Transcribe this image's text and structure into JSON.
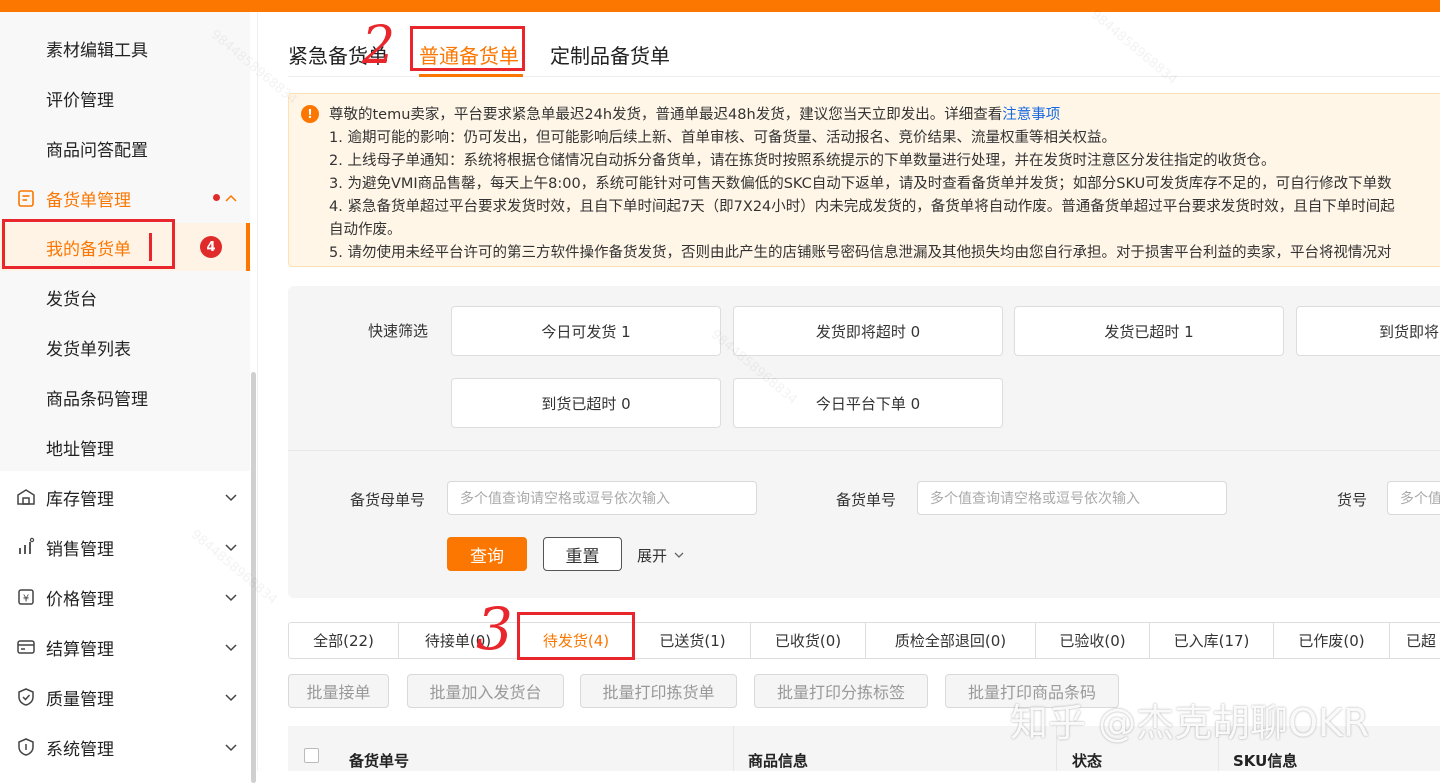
{
  "sidebar": {
    "sub_items": [
      "素材编辑工具",
      "评价管理",
      "商品问答配置"
    ],
    "group_title": "备货单管理",
    "active_item": "我的备货单",
    "active_badge": "4",
    "group_items": [
      "发货台",
      "发货单列表",
      "商品条码管理",
      "地址管理"
    ],
    "collapsed_groups": [
      "库存管理",
      "销售管理",
      "价格管理",
      "结算管理",
      "质量管理",
      "系统管理"
    ]
  },
  "tabs": [
    "紧急备货单",
    "普通备货单",
    "定制品备货单"
  ],
  "notice": {
    "line0_prefix": "尊敬的temu卖家，平台要求紧急单最迟24h发货，普通单最迟48h发货，建议您当天立即发出。详细查看",
    "line0_link": "注意事项",
    "lines": [
      "1. 逾期可能的影响：仍可发出，但可能影响后续上新、首单审核、可备货量、活动报名、竞价结果、流量权重等相关权益。",
      "2. 上线母子单通知：系统将根据仓储情况自动拆分备货单，请在拣货时按照系统提示的下单数量进行处理，并在发货时注意区分发往指定的收货仓。",
      "3. 为避免VMI商品售罄，每天上午8:00，系统可能针对可售天数偏低的SKC自动下返单，请及时查看备货单并发货；如部分SKU可发货库存不足的，可自行修改下单数",
      "4. 紧急备货单超过平台要求发货时效，且自下单时间起7天（即7X24小时）内未完成发货的，备货单将自动作废。普通备货单超过平台要求发货时效，且自下单时间起",
      "自动作废。",
      "5. 请勿使用未经平台许可的第三方软件操作备货发货，否则由此产生的店铺账号密码信息泄漏及其他损失均由您自行承担。对于损害平台利益的卖家，平台将视情况对"
    ]
  },
  "quick_filter": {
    "label": "快速筛选",
    "buttons": [
      "今日可发货 1",
      "发货即将超时 0",
      "发货已超时 1",
      "到货即将",
      "到货已超时 0",
      "今日平台下单 0"
    ]
  },
  "search": {
    "parent_order_label": "备货母单号",
    "parent_order_placeholder": "多个值查询请空格或逗号依次输入",
    "order_label": "备货单号",
    "order_placeholder": "多个值查询请空格或逗号依次输入",
    "item_no_label": "货号",
    "item_no_placeholder": "多个值",
    "query_button": "查询",
    "reset_button": "重置",
    "expand_label": "展开"
  },
  "status_tabs": [
    "全部(22)",
    "待接单(0)",
    "待发货(4)",
    "已送货(1)",
    "已收货(0)",
    "质检全部退回(0)",
    "已验收(0)",
    "已入库(17)",
    "已作废(0)",
    "已超"
  ],
  "batch_buttons": [
    "批量接单",
    "批量加入发货台",
    "批量打印拣货单",
    "批量打印分拣标签",
    "批量打印商品条码"
  ],
  "table_headers": [
    "备货单号",
    "商品信息",
    "状态",
    "SKU信息"
  ],
  "annotations": {
    "mark2": "2",
    "mark3": "3"
  },
  "watermark": "知乎 @杰克胡聊OKR",
  "bg_watermark": "9844858968834",
  "colors": {
    "accent": "#fb7701",
    "annotation_red": "#e8262b",
    "badge_red": "#e02b2b",
    "link_blue": "#1769e0"
  }
}
